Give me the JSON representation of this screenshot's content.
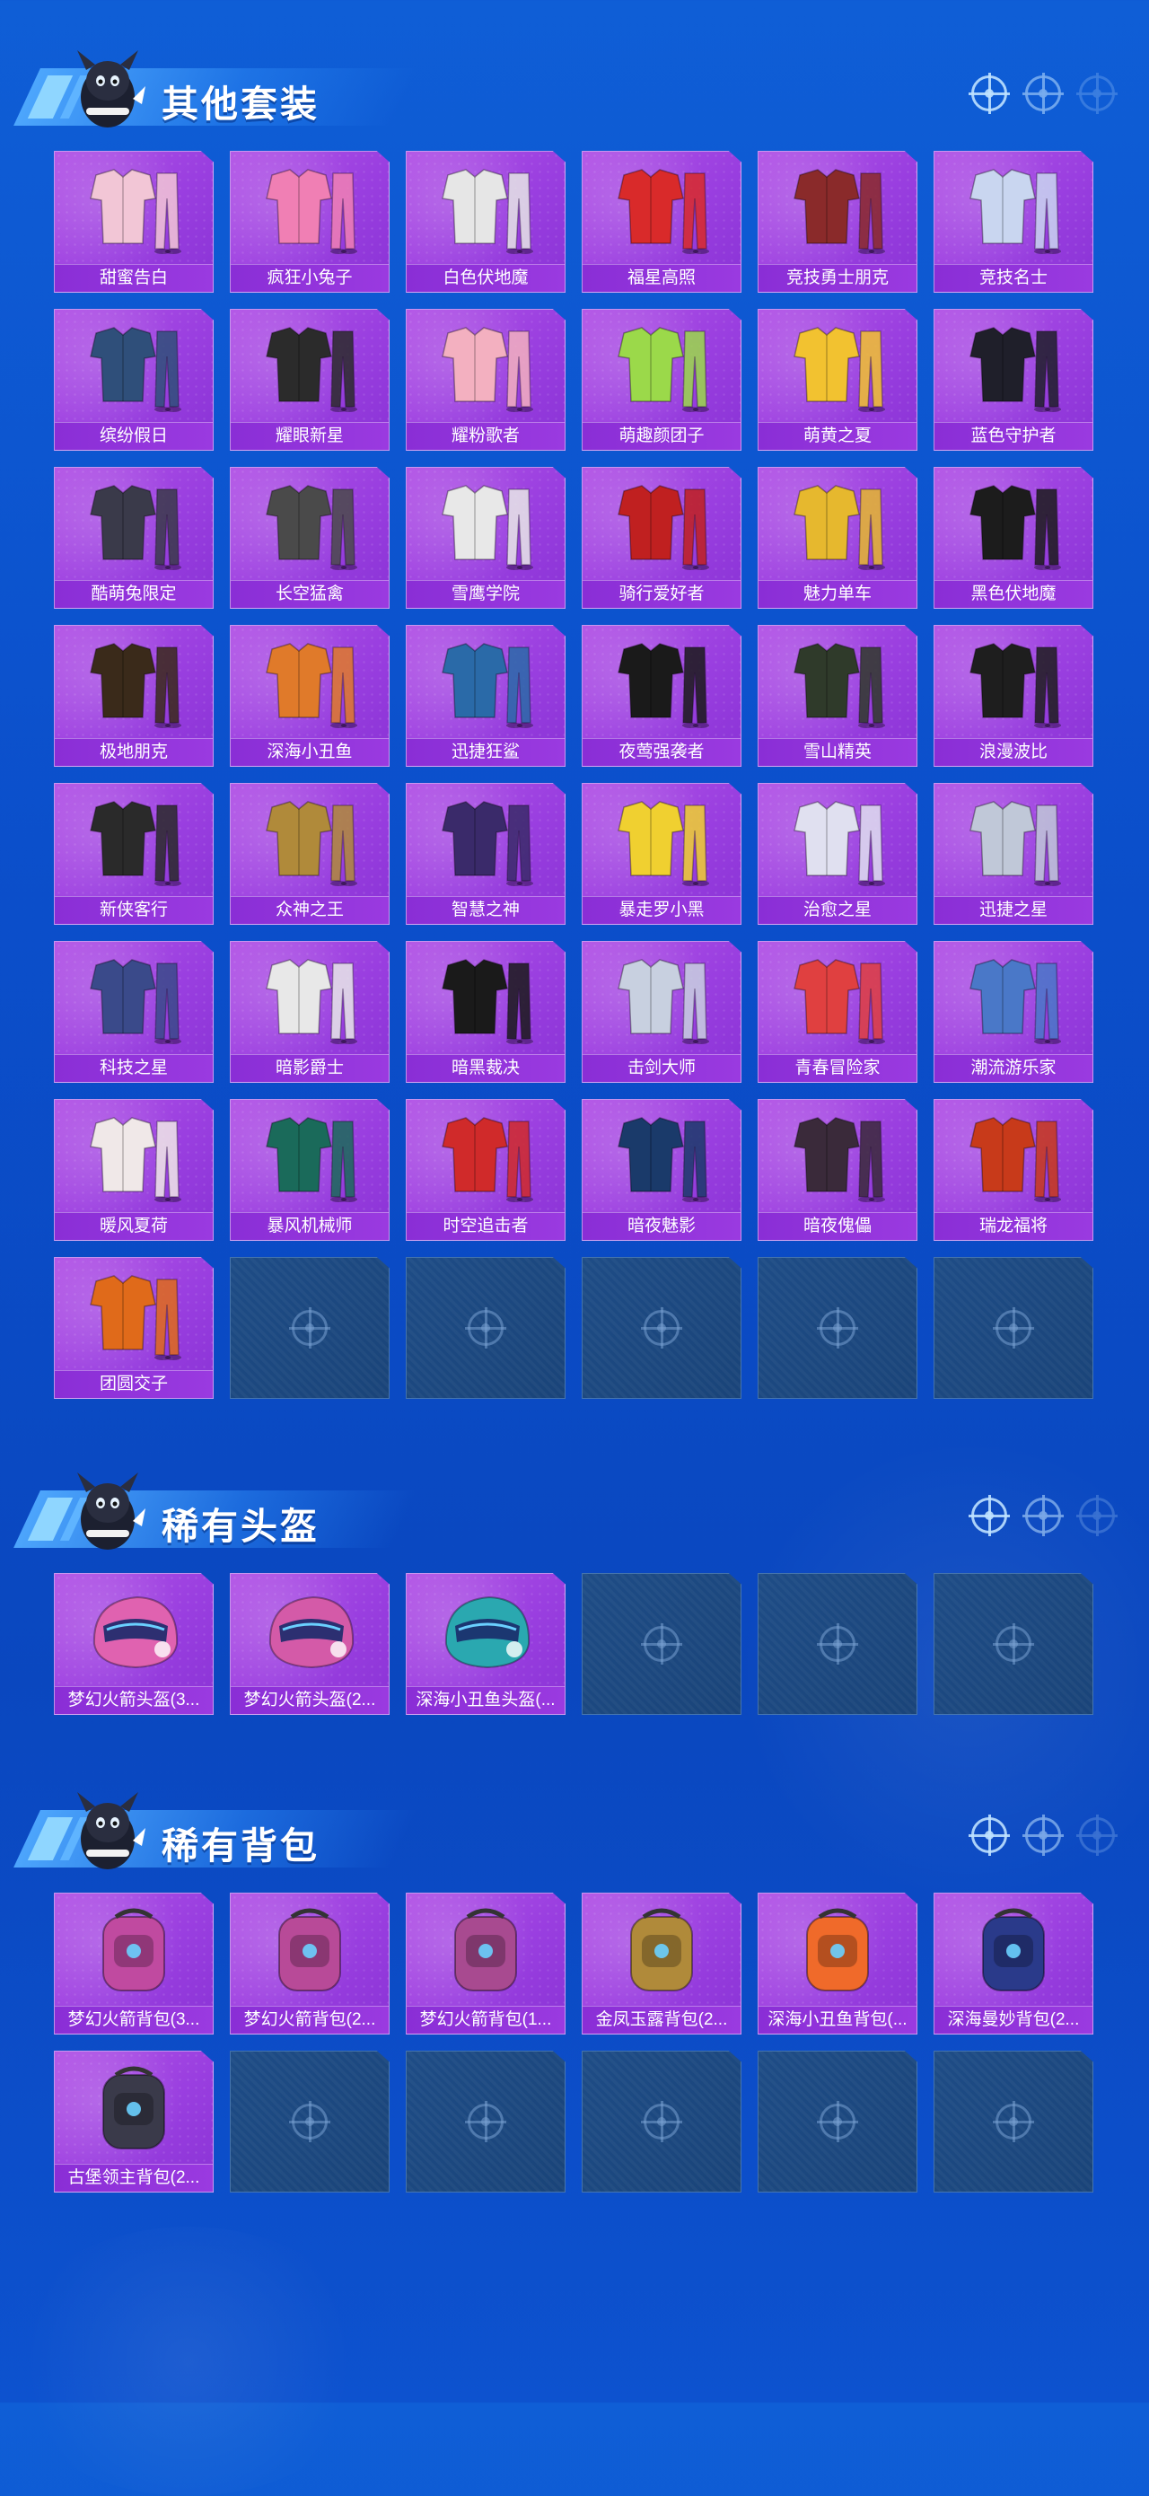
{
  "sections": [
    {
      "title": "其他套装",
      "icon": "mascot-icon",
      "items": [
        {
          "label": "甜蜜告白",
          "icon": "outfit-icon",
          "color": "#f2c6d6"
        },
        {
          "label": "疯狂小兔子",
          "icon": "outfit-icon",
          "color": "#f07fb4"
        },
        {
          "label": "白色伏地魔",
          "icon": "outfit-icon",
          "color": "#e6e6e6"
        },
        {
          "label": "福星高照",
          "icon": "outfit-icon",
          "color": "#d92a2a"
        },
        {
          "label": "竞技勇士朋克",
          "icon": "outfit-icon",
          "color": "#8a2a2a"
        },
        {
          "label": "竞技名士",
          "icon": "outfit-icon",
          "color": "#c9d6f0"
        },
        {
          "label": "缤纷假日",
          "icon": "outfit-icon",
          "color": "#2f4f7a"
        },
        {
          "label": "耀眼新星",
          "icon": "outfit-icon",
          "color": "#2b2b2b"
        },
        {
          "label": "耀粉歌者",
          "icon": "outfit-icon",
          "color": "#f3b0c0"
        },
        {
          "label": "萌趣颜团子",
          "icon": "outfit-icon",
          "color": "#9bd94a"
        },
        {
          "label": "萌黄之夏",
          "icon": "outfit-icon",
          "color": "#f2c230"
        },
        {
          "label": "蓝色守护者",
          "icon": "outfit-icon",
          "color": "#1f1f2a"
        },
        {
          "label": "酷萌兔限定",
          "icon": "outfit-icon",
          "color": "#3a3a4a"
        },
        {
          "label": "长空猛禽",
          "icon": "outfit-icon",
          "color": "#4a4a4a"
        },
        {
          "label": "雪鹰学院",
          "icon": "outfit-icon",
          "color": "#e8e8e8"
        },
        {
          "label": "骑行爱好者",
          "icon": "outfit-icon",
          "color": "#c02020"
        },
        {
          "label": "魅力单车",
          "icon": "outfit-icon",
          "color": "#e6b82e"
        },
        {
          "label": "黑色伏地魔",
          "icon": "outfit-icon",
          "color": "#1c1c1c"
        },
        {
          "label": "极地朋克",
          "icon": "outfit-icon",
          "color": "#3a2a1a"
        },
        {
          "label": "深海小丑鱼",
          "icon": "outfit-icon",
          "color": "#e07a2a"
        },
        {
          "label": "迅捷狂鲨",
          "icon": "outfit-icon",
          "color": "#2a6aa8"
        },
        {
          "label": "夜莺强袭者",
          "icon": "outfit-icon",
          "color": "#1a1a1a"
        },
        {
          "label": "雪山精英",
          "icon": "outfit-icon",
          "color": "#2f3a2a"
        },
        {
          "label": "浪漫波比",
          "icon": "outfit-icon",
          "color": "#1e1e1e"
        },
        {
          "label": "新侠客行",
          "icon": "outfit-icon",
          "color": "#2a2a2a"
        },
        {
          "label": "众神之王",
          "icon": "outfit-icon",
          "color": "#b08a3a"
        },
        {
          "label": "智慧之神",
          "icon": "outfit-icon",
          "color": "#3a2a6a"
        },
        {
          "label": "暴走罗小黑",
          "icon": "outfit-icon",
          "color": "#f0d030"
        },
        {
          "label": "治愈之星",
          "icon": "outfit-icon",
          "color": "#e0e0f0"
        },
        {
          "label": "迅捷之星",
          "icon": "outfit-icon",
          "color": "#c0c8d8"
        },
        {
          "label": "科技之星",
          "icon": "outfit-icon",
          "color": "#3a4a8a"
        },
        {
          "label": "暗影爵士",
          "icon": "outfit-icon",
          "color": "#e8e8e8"
        },
        {
          "label": "暗黑裁决",
          "icon": "outfit-icon",
          "color": "#1a1a1a"
        },
        {
          "label": "击剑大师",
          "icon": "outfit-icon",
          "color": "#c8d0e0"
        },
        {
          "label": "青春冒险家",
          "icon": "outfit-icon",
          "color": "#e04040"
        },
        {
          "label": "潮流游乐家",
          "icon": "outfit-icon",
          "color": "#4a78c8"
        },
        {
          "label": "暖风夏荷",
          "icon": "outfit-icon",
          "color": "#f0e8e8"
        },
        {
          "label": "暴风机械师",
          "icon": "outfit-icon",
          "color": "#1a6a5a"
        },
        {
          "label": "时空追击者",
          "icon": "outfit-icon",
          "color": "#d02a2a"
        },
        {
          "label": "暗夜魅影",
          "icon": "outfit-icon",
          "color": "#1a3a6a"
        },
        {
          "label": "暗夜傀儡",
          "icon": "outfit-icon",
          "color": "#3a2a3a"
        },
        {
          "label": "瑞龙福将",
          "icon": "outfit-icon",
          "color": "#c83a1a"
        },
        {
          "label": "团圆交子",
          "icon": "outfit-icon",
          "color": "#e06a1a"
        }
      ]
    },
    {
      "title": "稀有头盔",
      "icon": "mascot-icon",
      "items": [
        {
          "label": "梦幻火箭头盔(3...",
          "icon": "helmet-icon",
          "color": "#e062b0"
        },
        {
          "label": "梦幻火箭头盔(2...",
          "icon": "helmet-icon",
          "color": "#d45aa8"
        },
        {
          "label": "深海小丑鱼头盔(...",
          "icon": "helmet-icon",
          "color": "#2aa8b0"
        }
      ]
    },
    {
      "title": "稀有背包",
      "icon": "mascot-icon",
      "items": [
        {
          "label": "梦幻火箭背包(3...",
          "icon": "backpack-icon",
          "color": "#c04aa0"
        },
        {
          "label": "梦幻火箭背包(2...",
          "icon": "backpack-icon",
          "color": "#b84a98"
        },
        {
          "label": "梦幻火箭背包(1...",
          "icon": "backpack-icon",
          "color": "#a84a90"
        },
        {
          "label": "金凤玉露背包(2...",
          "icon": "backpack-icon",
          "color": "#b08a3a"
        },
        {
          "label": "深海小丑鱼背包(...",
          "icon": "backpack-icon",
          "color": "#f06a2a"
        },
        {
          "label": "深海曼妙背包(2...",
          "icon": "backpack-icon",
          "color": "#2a3a8a"
        },
        {
          "label": "古堡领主背包(2...",
          "icon": "backpack-icon",
          "color": "#3a3a4a"
        }
      ]
    }
  ]
}
